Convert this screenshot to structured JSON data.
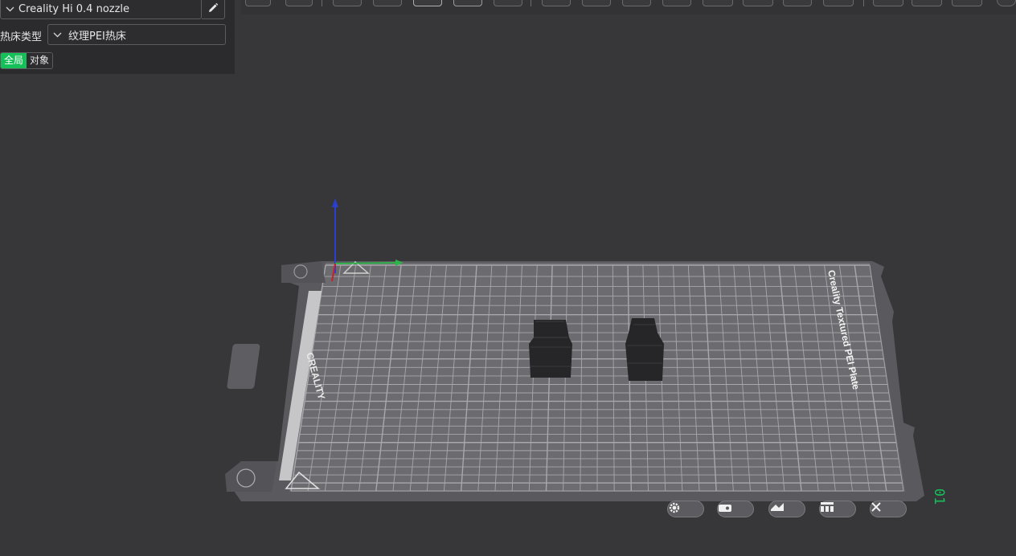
{
  "printer": {
    "name": "Creality Hi 0.4 nozzle"
  },
  "bed": {
    "label": "热床类型",
    "type": "纹理PEI热床"
  },
  "scope": {
    "global": "全局",
    "object": "对象"
  },
  "plate": {
    "title": "Creality Textured PEI Plate",
    "brand": "CREALITY",
    "index": "01"
  },
  "colors": {
    "accent": "#15c059",
    "background": "#37373a",
    "panel": "#2b2b2e",
    "plate": "#6e6e72",
    "grid": "#a8a8ac",
    "axis_x": "#c8202a",
    "axis_y": "#2fb34a",
    "axis_z": "#2a3fd0"
  },
  "icons": {
    "edit": "pencil-icon",
    "dropdown": "chevron-down-icon",
    "plate_settings": "gear-icon",
    "plate_lock": "lock-icon",
    "plate_auto_orient": "auto-orient-icon",
    "plate_arrange": "arrange-icon",
    "plate_delete": "close-icon"
  }
}
